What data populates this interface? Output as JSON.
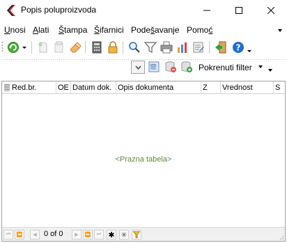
{
  "window": {
    "title": "Popis poluproizvoda",
    "minimize_label": "–",
    "maximize_label": "□",
    "close_label": "✕"
  },
  "menu": {
    "items": [
      {
        "prefix": "",
        "underlined": "U",
        "rest": "nosi"
      },
      {
        "prefix": "",
        "underlined": "A",
        "rest": "lati"
      },
      {
        "prefix": "",
        "underlined": "Š",
        "rest": "tampa"
      },
      {
        "prefix": "",
        "underlined": "Š",
        "rest": "ifarnici"
      },
      {
        "prefix": "Pode",
        "underlined": "š",
        "rest": "avanje"
      },
      {
        "prefix": "Pomo",
        "underlined": "ć",
        "rest": ""
      }
    ]
  },
  "toolbar": {
    "icons": [
      "refresh-icon",
      "new-doc-icon",
      "copy-icon",
      "eraser-icon",
      "calculator-icon",
      "lock-icon",
      "search-icon",
      "filter-icon",
      "print-icon",
      "chart-icon",
      "edit-icon",
      "exit-icon",
      "help-icon"
    ]
  },
  "toolbar2": {
    "filter_label": "Pokrenuti filter"
  },
  "grid": {
    "columns": [
      "Red.br.",
      "OE",
      "Datum dok.",
      "Opis dokumenta",
      "Z",
      "Vrednost",
      "S"
    ],
    "empty_text": "<Prazna tabela>"
  },
  "navigator": {
    "record_text": "0 of 0"
  },
  "colors": {
    "empty_text": "#5b8a3c",
    "accent_green": "#3aa040",
    "accent_blue": "#1f6fd0",
    "accent_orange": "#e89a2c"
  }
}
